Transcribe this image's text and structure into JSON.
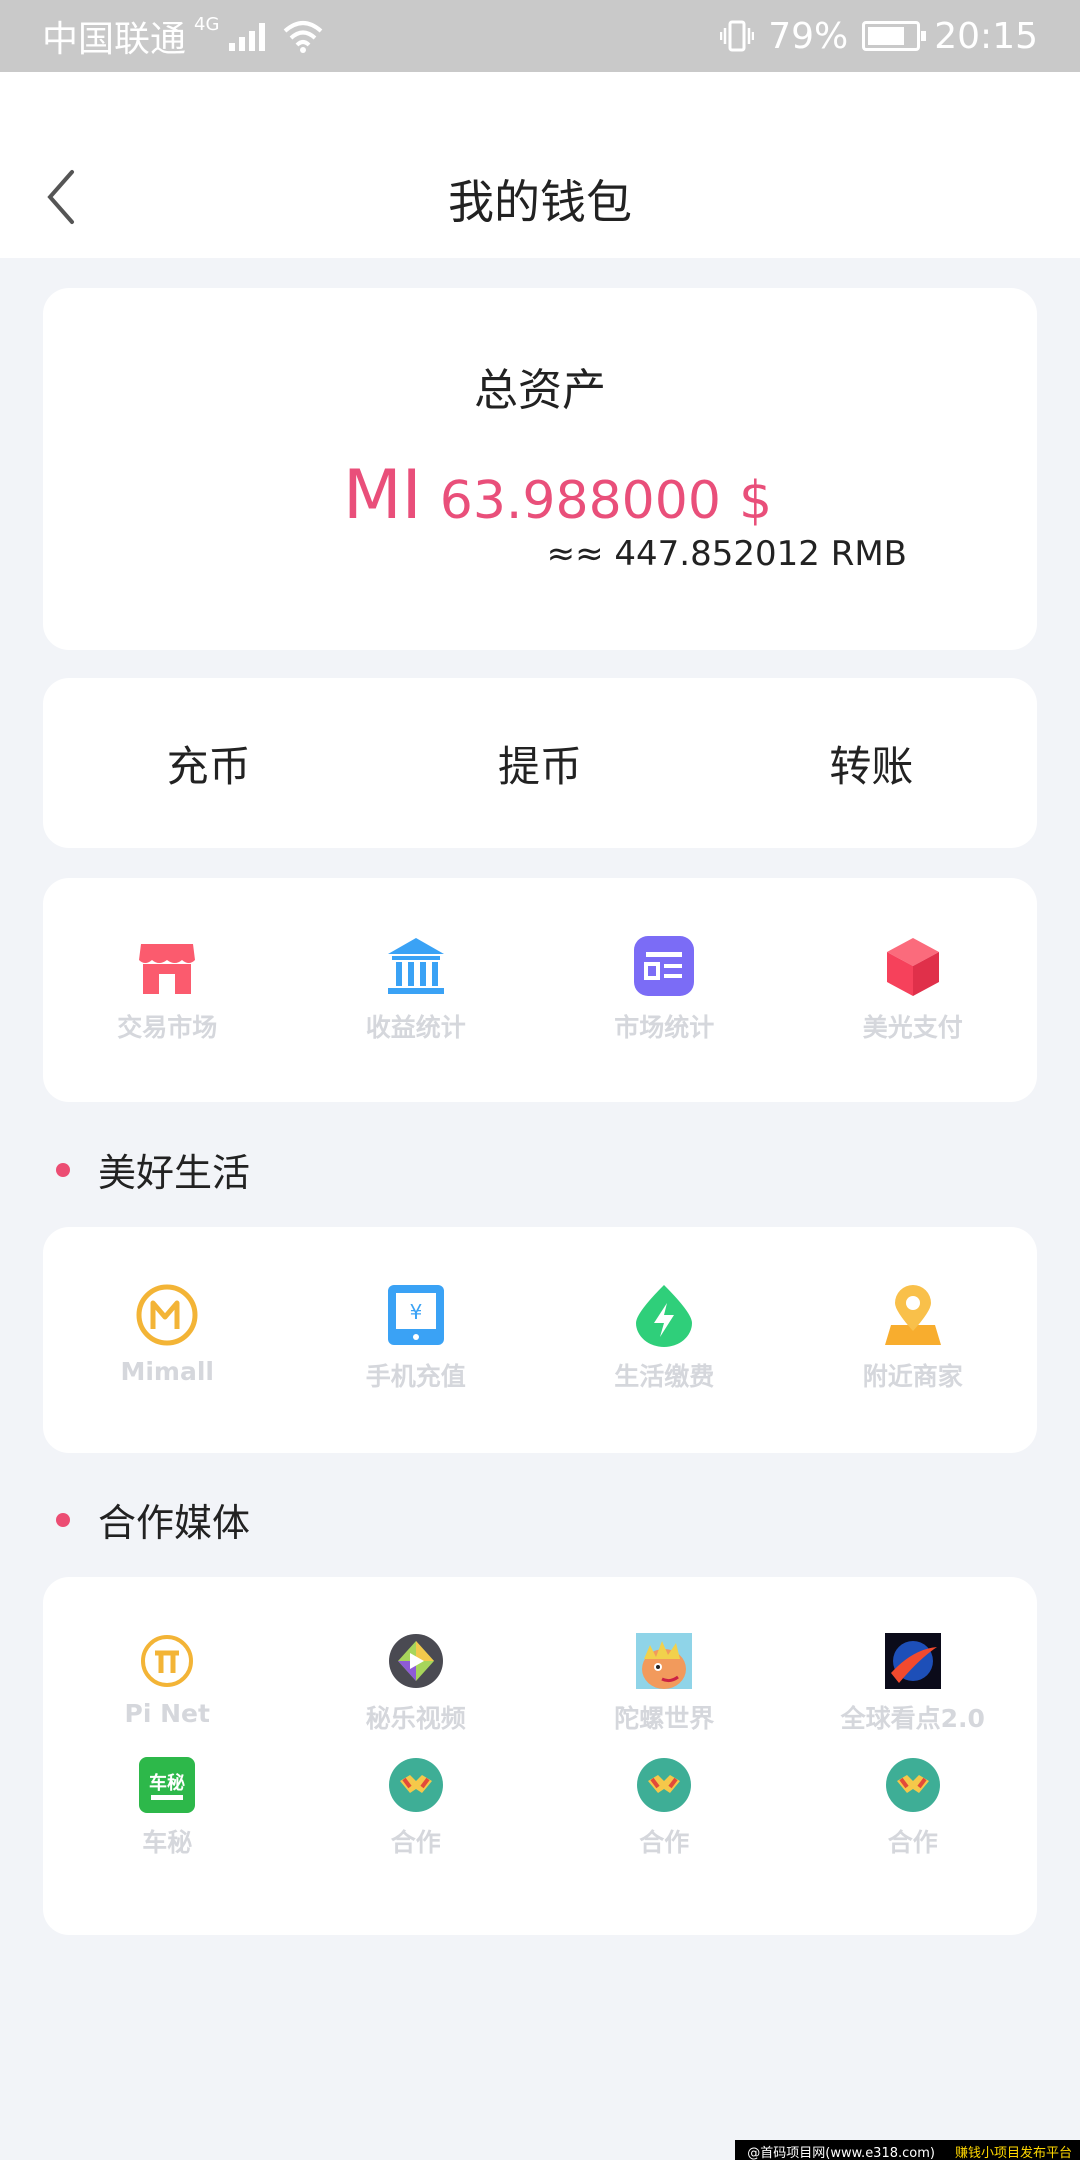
{
  "status_bar": {
    "carrier": "中国联通",
    "network": "4G",
    "battery": "79%",
    "time": "20:15",
    "battery_level": 0.79
  },
  "header": {
    "title": "我的钱包"
  },
  "assets": {
    "label": "总资产",
    "currency_symbol": "MI",
    "amount": "63.988000",
    "amount_unit": "$",
    "rmb": "≈≈ 447.852012 RMB"
  },
  "actions": [
    {
      "label": "充币"
    },
    {
      "label": "提币"
    },
    {
      "label": "转账"
    }
  ],
  "tools": [
    {
      "label": "交易市场",
      "icon": "shop-icon",
      "color": "#fb5b6e"
    },
    {
      "label": "收益统计",
      "icon": "bank-icon",
      "color": "#3aa2f5"
    },
    {
      "label": "市场统计",
      "icon": "stats-card-icon",
      "color": "#7b6cf6"
    },
    {
      "label": "美光支付",
      "icon": "cube-icon",
      "color": "#f6415b"
    }
  ],
  "sections": {
    "life": "美好生活",
    "media": "合作媒体"
  },
  "life": [
    {
      "label": "Mimall",
      "icon": "mimall-icon",
      "color": "#f3b436"
    },
    {
      "label": "手机充值",
      "icon": "phone-recharge-icon",
      "color": "#3aa2f5"
    },
    {
      "label": "生活缴费",
      "icon": "bolt-drop-icon",
      "color": "#2fcf7a"
    },
    {
      "label": "附近商家",
      "icon": "location-pin-icon",
      "color": "#f8ad2e"
    }
  ],
  "media": [
    {
      "label": "Pi Net",
      "icon": "pi-net-icon"
    },
    {
      "label": "秘乐视频",
      "icon": "mile-video-icon"
    },
    {
      "label": "陀螺世界",
      "icon": "tuoluo-world-icon"
    },
    {
      "label": "全球看点2.0",
      "icon": "global-watch-icon"
    },
    {
      "label": "车秘",
      "icon": "chemi-icon"
    },
    {
      "label": "合作",
      "icon": "partner-icon"
    },
    {
      "label": "合作",
      "icon": "partner-icon"
    },
    {
      "label": "合作",
      "icon": "partner-icon"
    }
  ],
  "watermark": {
    "left": "@首码项目网(www.e318.com)",
    "right": "赚钱小项目发布平台"
  }
}
